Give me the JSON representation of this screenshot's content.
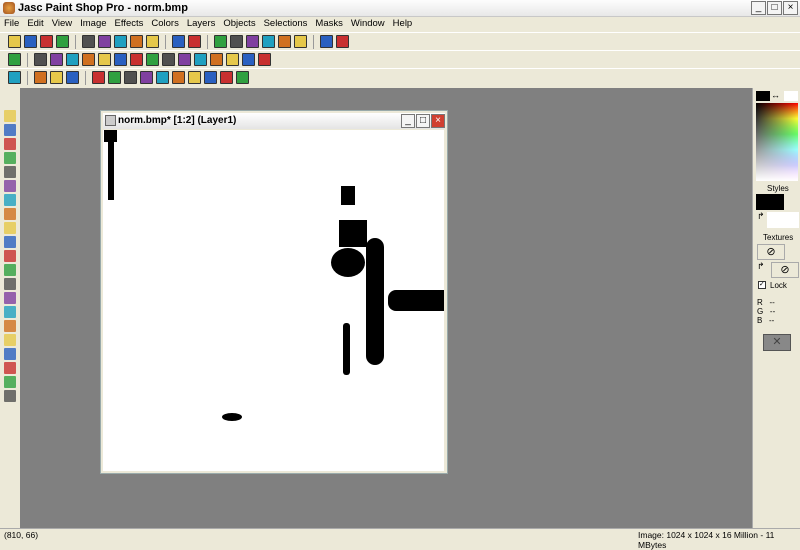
{
  "app": {
    "title": "Jasc Paint Shop Pro - norm.bmp"
  },
  "menu": [
    "File",
    "Edit",
    "View",
    "Image",
    "Effects",
    "Colors",
    "Layers",
    "Objects",
    "Selections",
    "Masks",
    "Window",
    "Help"
  ],
  "toolbar_rows": [
    [
      "new-icon",
      "open-icon",
      "save-icon",
      "print-icon",
      "|",
      "undo-icon",
      "redo-icon",
      "cut-icon",
      "copy-icon",
      "paste-icon",
      "|",
      "screen-icon",
      "browse-icon",
      "|",
      "overview-icon",
      "tool-options-icon",
      "color-palette-icon",
      "histogram-icon",
      "layer-palette-icon",
      "script-icon",
      "|",
      "help-icon",
      "lock-icon"
    ],
    [
      "camera-icon",
      "|",
      "effect1-icon",
      "effect2-icon",
      "effect3-icon",
      "effect4-icon",
      "effect5-icon",
      "effect6-icon",
      "effect7-icon",
      "effect8-icon",
      "effect9-icon",
      "effect10-icon",
      "effect11-icon",
      "effect12-icon",
      "effect13-icon",
      "effect14-icon",
      "effect15-icon"
    ],
    [
      "web-icon",
      "|",
      "highlight-icon",
      "smudge-icon",
      "frame-icon",
      "|",
      "filter1-icon",
      "filter2-icon",
      "filter3-icon",
      "filter4-icon",
      "filter5-icon",
      "filter6-icon",
      "filter7-icon",
      "filter8-icon",
      "filter9-icon",
      "filter10-icon"
    ]
  ],
  "colors": [
    "#e6c84a",
    "#2a60c0",
    "#c83030",
    "#30a040",
    "#505050",
    "#8040a0",
    "#20a0c0",
    "#d07020"
  ],
  "document": {
    "title": "norm.bmp* [1:2] (Layer1)"
  },
  "right_panel": {
    "styles_label": "Styles",
    "textures_label": "Textures",
    "lock_label": "Lock",
    "r_label": "R",
    "g_label": "G",
    "b_label": "B",
    "r_value": "--",
    "g_value": "--",
    "b_value": "--"
  },
  "status": {
    "coords": "(810, 66)",
    "image_info": "Image:  1024 x 1024 x 16 Million - 11 MBytes"
  }
}
